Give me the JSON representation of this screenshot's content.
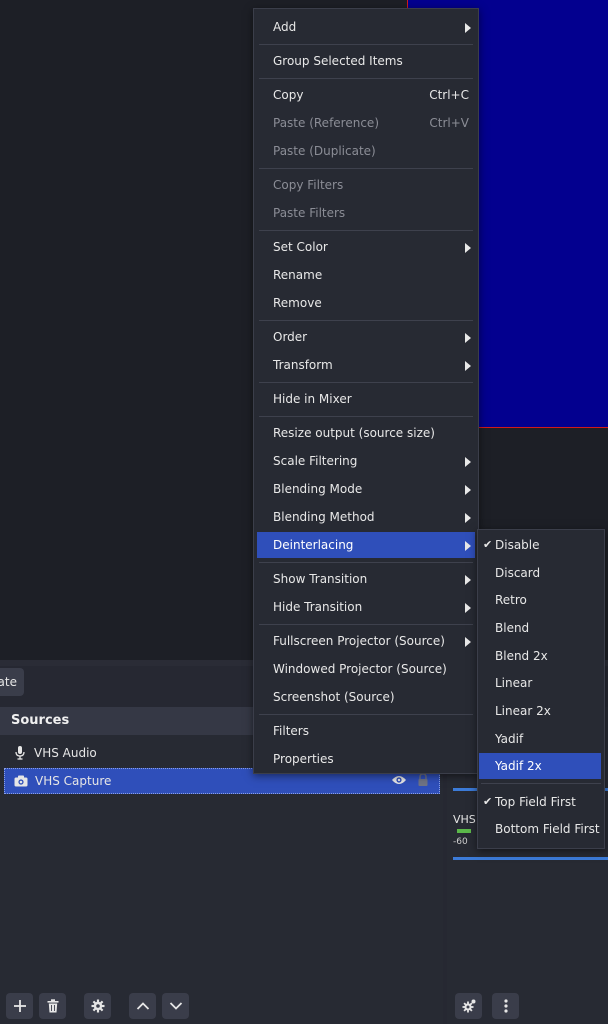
{
  "context_menu": {
    "items": [
      {
        "label": "Add",
        "shortcut": "",
        "submenu": true,
        "disabled": false
      },
      {
        "label": "Group Selected Items",
        "shortcut": "",
        "submenu": false,
        "disabled": false
      },
      {
        "label": "Copy",
        "shortcut": "Ctrl+C",
        "submenu": false,
        "disabled": false
      },
      {
        "label": "Paste (Reference)",
        "shortcut": "Ctrl+V",
        "submenu": false,
        "disabled": true
      },
      {
        "label": "Paste (Duplicate)",
        "shortcut": "",
        "submenu": false,
        "disabled": true
      },
      {
        "label": "Copy Filters",
        "shortcut": "",
        "submenu": false,
        "disabled": true
      },
      {
        "label": "Paste Filters",
        "shortcut": "",
        "submenu": false,
        "disabled": true
      },
      {
        "label": "Set Color",
        "shortcut": "",
        "submenu": true,
        "disabled": false
      },
      {
        "label": "Rename",
        "shortcut": "",
        "submenu": false,
        "disabled": false
      },
      {
        "label": "Remove",
        "shortcut": "",
        "submenu": false,
        "disabled": false
      },
      {
        "label": "Order",
        "shortcut": "",
        "submenu": true,
        "disabled": false
      },
      {
        "label": "Transform",
        "shortcut": "",
        "submenu": true,
        "disabled": false
      },
      {
        "label": "Hide in Mixer",
        "shortcut": "",
        "submenu": false,
        "disabled": false
      },
      {
        "label": "Resize output (source size)",
        "shortcut": "",
        "submenu": false,
        "disabled": false
      },
      {
        "label": "Scale Filtering",
        "shortcut": "",
        "submenu": true,
        "disabled": false
      },
      {
        "label": "Blending Mode",
        "shortcut": "",
        "submenu": true,
        "disabled": false
      },
      {
        "label": "Blending Method",
        "shortcut": "",
        "submenu": true,
        "disabled": false
      },
      {
        "label": "Deinterlacing",
        "shortcut": "",
        "submenu": true,
        "disabled": false,
        "active": true
      },
      {
        "label": "Show Transition",
        "shortcut": "",
        "submenu": true,
        "disabled": false
      },
      {
        "label": "Hide Transition",
        "shortcut": "",
        "submenu": true,
        "disabled": false
      },
      {
        "label": "Fullscreen Projector (Source)",
        "shortcut": "",
        "submenu": true,
        "disabled": false
      },
      {
        "label": "Windowed Projector (Source)",
        "shortcut": "",
        "submenu": false,
        "disabled": false
      },
      {
        "label": "Screenshot (Source)",
        "shortcut": "",
        "submenu": false,
        "disabled": false
      },
      {
        "label": "Filters",
        "shortcut": "",
        "submenu": false,
        "disabled": false
      },
      {
        "label": "Properties",
        "shortcut": "",
        "submenu": false,
        "disabled": false
      }
    ]
  },
  "deinterlacing_submenu": {
    "items": [
      {
        "label": "Disable",
        "checked": true,
        "active": false
      },
      {
        "label": "Discard",
        "checked": false,
        "active": false
      },
      {
        "label": "Retro",
        "checked": false,
        "active": false
      },
      {
        "label": "Blend",
        "checked": false,
        "active": false
      },
      {
        "label": "Blend 2x",
        "checked": false,
        "active": false
      },
      {
        "label": "Linear",
        "checked": false,
        "active": false
      },
      {
        "label": "Linear 2x",
        "checked": false,
        "active": false
      },
      {
        "label": "Yadif",
        "checked": false,
        "active": false
      },
      {
        "label": "Yadif 2x",
        "checked": false,
        "active": true
      },
      {
        "label": "Top Field First",
        "checked": true,
        "active": false
      },
      {
        "label": "Bottom Field First",
        "checked": false,
        "active": false
      }
    ],
    "check_glyph": "✔"
  },
  "sources": {
    "title": "Sources",
    "items": [
      {
        "name": "VHS Audio",
        "icon": "microphone-icon",
        "selected": false
      },
      {
        "name": "VHS Capture",
        "icon": "camera-icon",
        "selected": true
      }
    ]
  },
  "controls": {
    "partial_button_label": "ate"
  },
  "audio_mixer": {
    "source_label": "VHS",
    "scale_label": "-60"
  },
  "colors": {
    "accent": "#2f4fba",
    "canvas_bg": "#03008f",
    "canvas_border": "#d11b1b",
    "meter_blue": "#3c7bd8"
  }
}
